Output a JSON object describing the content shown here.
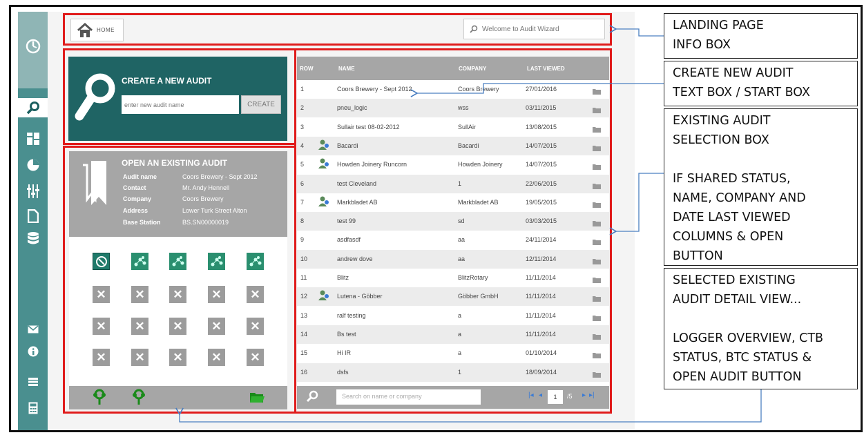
{
  "header": {
    "home_label": "HOME",
    "welcome_text": "Welcome to Audit Wizard"
  },
  "sidebar": {
    "icons": [
      "gauge-icon",
      "search-icon",
      "dashboard-icon",
      "pie-chart-icon",
      "sliders-icon",
      "document-icon",
      "database-icon",
      "mail-icon",
      "info-icon",
      "menu-icon",
      "calculator-icon"
    ]
  },
  "create": {
    "title": "CREATE A NEW AUDIT",
    "placeholder": "enter new audit name",
    "button": "CREATE"
  },
  "open_existing": {
    "title": "OPEN AN EXISTING AUDIT",
    "details": [
      {
        "key": "Audit name",
        "value": "Coors Brewery - Sept 2012"
      },
      {
        "key": "Contact",
        "value": "Mr. Andy Hennell"
      },
      {
        "key": "Company",
        "value": "Coors Brewery"
      },
      {
        "key": "Address",
        "value": "Lower Turk Street Alton"
      },
      {
        "key": "Base Station",
        "value": "BS.SN00000019"
      }
    ]
  },
  "table": {
    "columns": [
      "ROW",
      "NAME",
      "COMPANY",
      "LAST VIEWED"
    ],
    "rows": [
      {
        "row": "1",
        "name": "Coors Brewery - Sept 2012",
        "company": "Coors Brewery",
        "last_viewed": "27/01/2016",
        "shared": false
      },
      {
        "row": "2",
        "name": "pneu_logic",
        "company": "wss",
        "last_viewed": "03/11/2015",
        "shared": false
      },
      {
        "row": "3",
        "name": "Sullair test 08-02-2012",
        "company": "SullAir",
        "last_viewed": "13/08/2015",
        "shared": false
      },
      {
        "row": "4",
        "name": "Bacardi",
        "company": "Bacardi",
        "last_viewed": "14/07/2015",
        "shared": true
      },
      {
        "row": "5",
        "name": "Howden Joinery Runcorn",
        "company": "Howden Joinery",
        "last_viewed": "14/07/2015",
        "shared": true
      },
      {
        "row": "6",
        "name": "test Cleveland",
        "company": "1",
        "last_viewed": "22/06/2015",
        "shared": false
      },
      {
        "row": "7",
        "name": "Markbladet AB",
        "company": "Markbladet AB",
        "last_viewed": "19/05/2015",
        "shared": true
      },
      {
        "row": "8",
        "name": "test 99",
        "company": "sd",
        "last_viewed": "03/03/2015",
        "shared": false
      },
      {
        "row": "9",
        "name": "asdfasdf",
        "company": "aa",
        "last_viewed": "24/11/2014",
        "shared": false
      },
      {
        "row": "10",
        "name": "andrew dove",
        "company": "aa",
        "last_viewed": "12/11/2014",
        "shared": false
      },
      {
        "row": "11",
        "name": "Blitz",
        "company": "BlitzRotary",
        "last_viewed": "11/11/2014",
        "shared": false
      },
      {
        "row": "12",
        "name": "Lutena - Göbber",
        "company": "Göbber GmbH",
        "last_viewed": "11/11/2014",
        "shared": true
      },
      {
        "row": "13",
        "name": "ralf testing",
        "company": "a",
        "last_viewed": "11/11/2014",
        "shared": false
      },
      {
        "row": "14",
        "name": "Bs test",
        "company": "a",
        "last_viewed": "11/11/2014",
        "shared": false
      },
      {
        "row": "15",
        "name": "Hi IR",
        "company": "a",
        "last_viewed": "01/10/2014",
        "shared": false
      },
      {
        "row": "16",
        "name": "dsfs",
        "company": "1",
        "last_viewed": "18/09/2014",
        "shared": false
      }
    ],
    "search_placeholder": "Search on name or company",
    "page": "1",
    "page_total": "/5"
  },
  "annotations": [
    "LANDING PAGE\nINFO BOX",
    "CREATE NEW AUDIT\nTEXT BOX / START BOX",
    "EXISTING AUDIT\nSELECTION BOX\n\nIF SHARED STATUS,\nNAME, COMPANY AND\nDATE LAST VIEWED\nCOLUMNS & OPEN\nBUTTON",
    "SELECTED  EXISTING\nAUDIT DETAIL VIEW...\n\nLOGGER OVERVIEW, CTB\nSTATUS, BTC STATUS &\nOPEN AUDIT BUTTON"
  ],
  "colors": {
    "teal_dark": "#1f6464",
    "teal_rail": "#4a8f8f",
    "panel_grey": "#a6a6a6",
    "highlight_red": "#e01b1b",
    "arrow_blue": "#4a7fc1"
  }
}
